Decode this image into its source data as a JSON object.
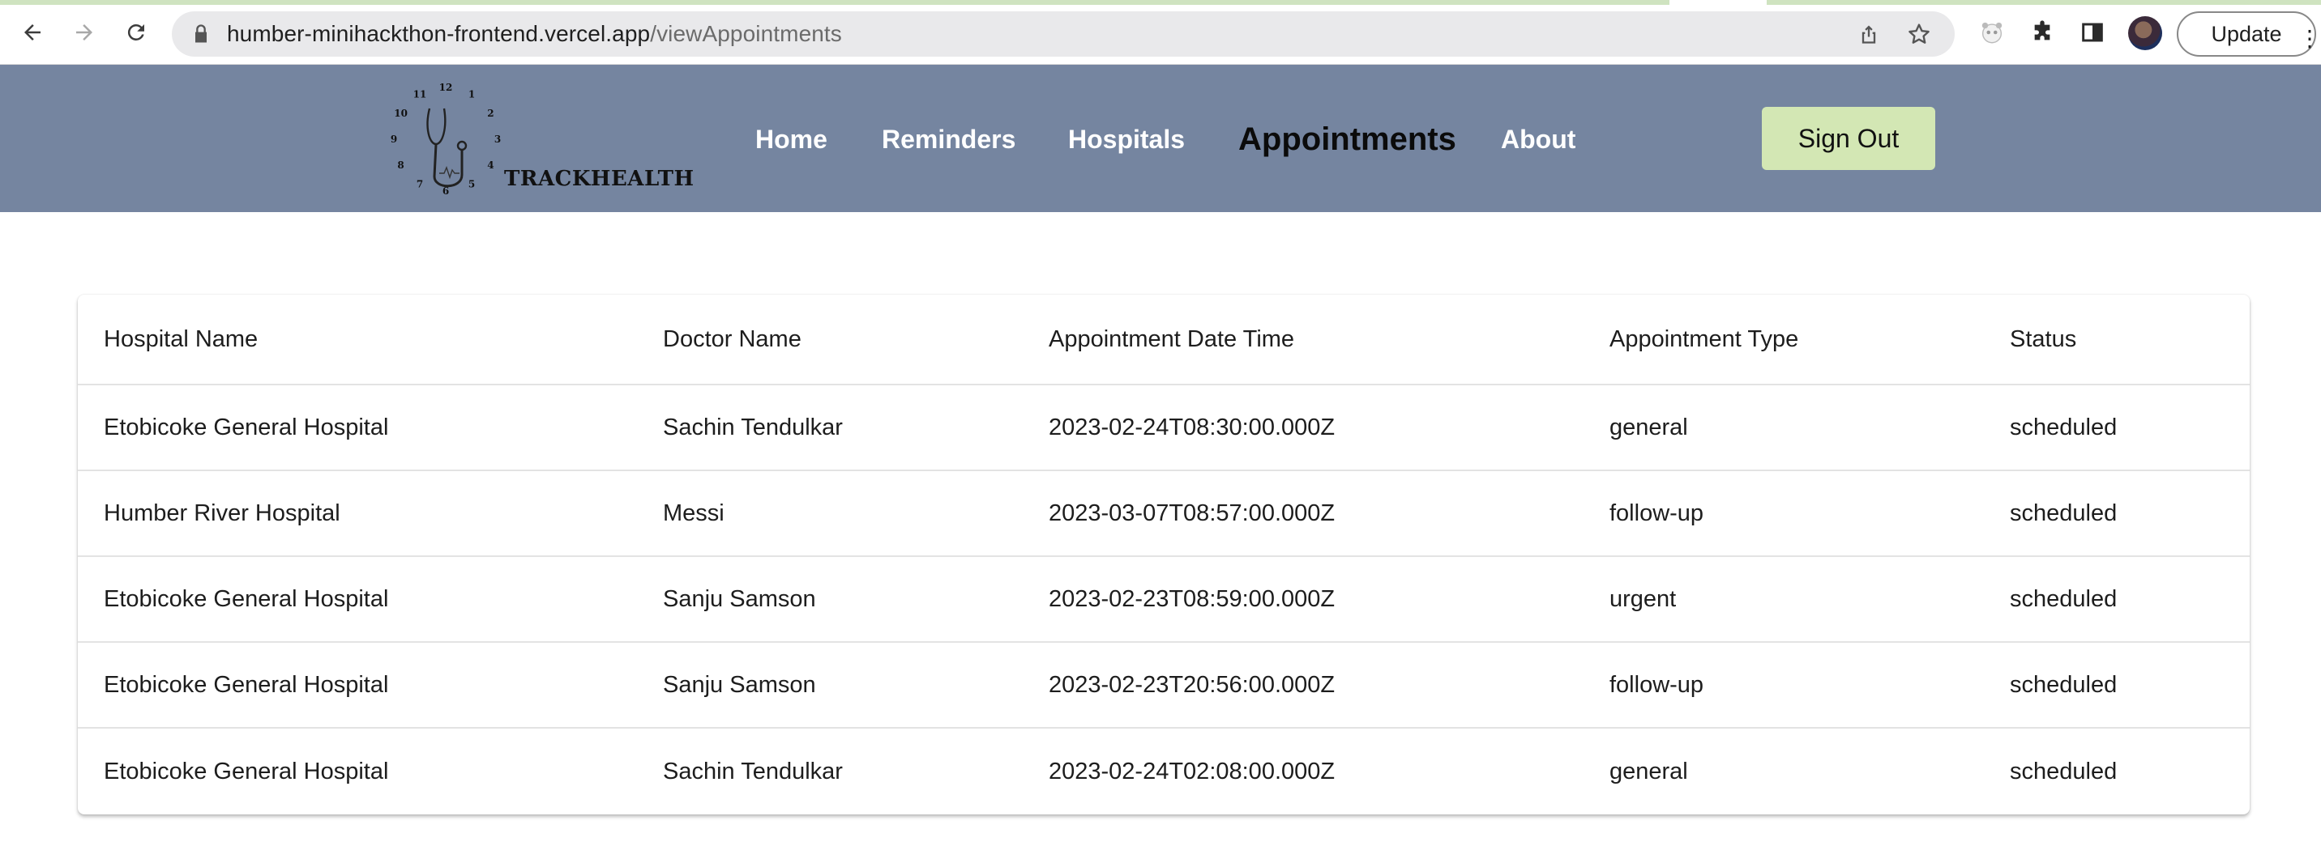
{
  "browser": {
    "url_host": "humber-minihackthon-frontend.vercel.app",
    "url_path": "/viewAppointments",
    "update_label": "Update",
    "update_menu": "⋮"
  },
  "site": {
    "brand": "TRACKHEALTH",
    "clock_numbers": [
      "12",
      "1",
      "2",
      "3",
      "4",
      "5",
      "6",
      "7",
      "8",
      "9",
      "10",
      "11"
    ],
    "nav": [
      {
        "label": "Home"
      },
      {
        "label": "Reminders"
      },
      {
        "label": "Hospitals"
      },
      {
        "label": "Appointments",
        "active": true
      },
      {
        "label": "About"
      }
    ],
    "signout_label": "Sign Out",
    "colors": {
      "header_bg": "#7585a0",
      "signout_bg": "#d3e7b4",
      "nav_text": "#ffffff",
      "nav_active": "#0b0b0b"
    }
  },
  "table": {
    "columns": [
      "Hospital Name",
      "Doctor Name",
      "Appointment Date Time",
      "Appointment Type",
      "Status"
    ],
    "rows": [
      [
        "Etobicoke General Hospital",
        "Sachin Tendulkar",
        "2023-02-24T08:30:00.000Z",
        "general",
        "scheduled"
      ],
      [
        "Humber River Hospital",
        "Messi",
        "2023-03-07T08:57:00.000Z",
        "follow-up",
        "scheduled"
      ],
      [
        "Etobicoke General Hospital",
        "Sanju Samson",
        "2023-02-23T08:59:00.000Z",
        "urgent",
        "scheduled"
      ],
      [
        "Etobicoke General Hospital",
        "Sanju Samson",
        "2023-02-23T20:56:00.000Z",
        "follow-up",
        "scheduled"
      ],
      [
        "Etobicoke General Hospital",
        "Sachin Tendulkar",
        "2023-02-24T02:08:00.000Z",
        "general",
        "scheduled"
      ]
    ]
  }
}
